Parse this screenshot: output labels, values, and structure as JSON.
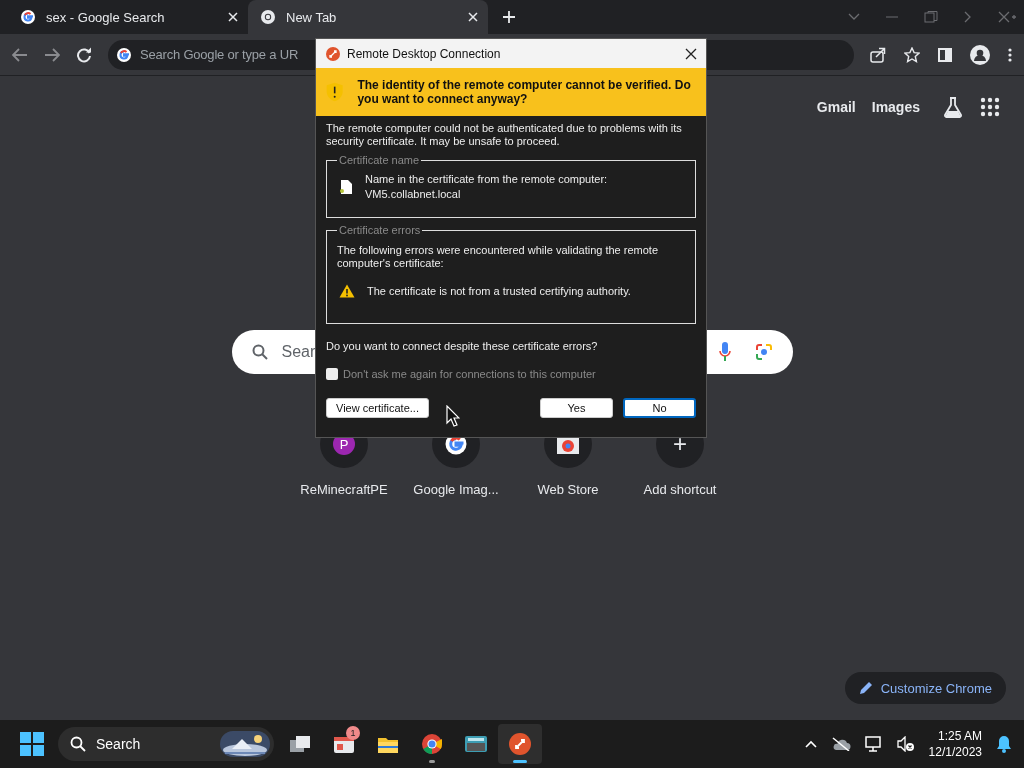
{
  "browser": {
    "tabs": [
      {
        "title": "sex - Google Search",
        "kind": "google",
        "selected": false
      },
      {
        "title": "New Tab",
        "kind": "chrome",
        "selected": true
      }
    ],
    "omnibox": {
      "placeholder": "Search Google or type a UR"
    },
    "top_links": [
      "Gmail",
      "Images"
    ],
    "search": {
      "placeholder": "Sear"
    },
    "shortcuts": [
      {
        "label": "ReMinecraftPE",
        "kind": "letter",
        "letter": "P"
      },
      {
        "label": "Google Imag...",
        "kind": "google"
      },
      {
        "label": "Web Store",
        "kind": "store"
      },
      {
        "label": "Add shortcut",
        "kind": "add",
        "letter": "+"
      }
    ],
    "customize": "Customize Chrome"
  },
  "dialog": {
    "title": "Remote Desktop Connection",
    "banner": "The identity of the remote computer cannot be verified. Do you want to connect anyway?",
    "intro": "The remote computer could not be authenticated due to problems with its security certificate. It may be unsafe to proceed.",
    "cert_name": {
      "legend": "Certificate name",
      "lines": [
        "Name in the certificate from the remote computer:",
        "VM5.collabnet.local"
      ]
    },
    "cert_errors": {
      "legend": "Certificate errors",
      "text": "The following errors were encountered while validating the remote computer's certificate:",
      "error": "The certificate is not from a trusted certifying authority."
    },
    "question": "Do you want to connect despite these certificate errors?",
    "checkbox": {
      "label": "Don't ask me again for connections to this computer",
      "checked": false
    },
    "buttons": [
      {
        "label": "View certificate...",
        "focused": false
      },
      {
        "label": "Yes",
        "focused": false
      },
      {
        "label": "No",
        "focused": true
      }
    ]
  },
  "taskbar": {
    "search": "Search",
    "apps": [
      {
        "kind": "taskview",
        "running": false
      },
      {
        "kind": "widgets",
        "running": false,
        "badge": "1"
      },
      {
        "kind": "files",
        "running": false
      },
      {
        "kind": "chrome",
        "running": true
      },
      {
        "kind": "keyboard",
        "running": false
      },
      {
        "kind": "rdp",
        "running": true
      }
    ],
    "time": "1:25 AM",
    "date": "12/1/2023"
  }
}
